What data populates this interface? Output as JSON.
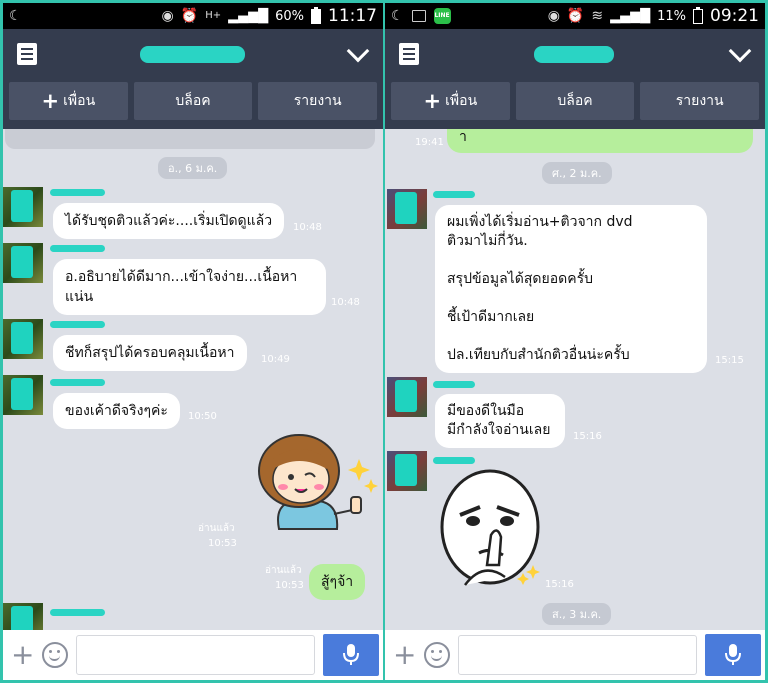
{
  "left": {
    "status": {
      "battery": "60%",
      "time": "11:17",
      "net": "H+"
    },
    "actions": {
      "add": "เพื่อน",
      "block": "บล็อค",
      "report": "รายงาน"
    },
    "top_partial_time": "",
    "date": "อ., 6 ม.ค.",
    "messages": [
      {
        "text": "ได้รับชุดติวแล้วค่ะ....เริ่มเปิดดูแล้ว",
        "time": "10:48"
      },
      {
        "text": "อ.อธิบายได้ดีมาก...เข้าใจง่าย...เนื้อหาแน่น",
        "time": "10:48"
      },
      {
        "text": "ชีทก็สรุปได้ครอบคลุมเนื้อหา",
        "time": "10:49"
      },
      {
        "text": "ของเค้าดีจริงๆค่ะ",
        "time": "10:50"
      }
    ],
    "sticker_read": "อ่านแล้ว",
    "sticker_time": "10:53",
    "reply_read": "อ่านแล้ว",
    "reply_time": "10:53",
    "reply_text": "สู้ๆจ้า"
  },
  "right": {
    "status": {
      "battery": "11%",
      "time": "09:21"
    },
    "actions": {
      "add": "เพื่อน",
      "block": "บล็อค",
      "report": "รายงาน"
    },
    "top_time": "19:41",
    "top_partial_text": "า",
    "date1": "ศ., 2 ม.ค.",
    "message1": "ผมเพิ่งได้เริ่มอ่าน+ติวจาก dvd\nติวมาไม่กี่วัน.\n\nสรุปข้อมูลได้สุดยอดครั้บ\n\nชี้เป้าดีมากเลย\n\nปล.เทียบกับสำนักติวอื่นน่ะครั้บ",
    "message1_time": "15:15",
    "message2": "มีของดีในมือ\nมีกำลังใจอ่านเลย",
    "message2_time": "15:16",
    "sticker_time": "15:16",
    "date2": "ส., 3 ม.ค."
  },
  "colors": {
    "header": "#343c4e",
    "button": "#4a5266",
    "chat_bg": "#dcdfe6",
    "green_bubble": "#b6ee9c",
    "mic": "#4a7bdb",
    "frame": "#33c3ad"
  }
}
